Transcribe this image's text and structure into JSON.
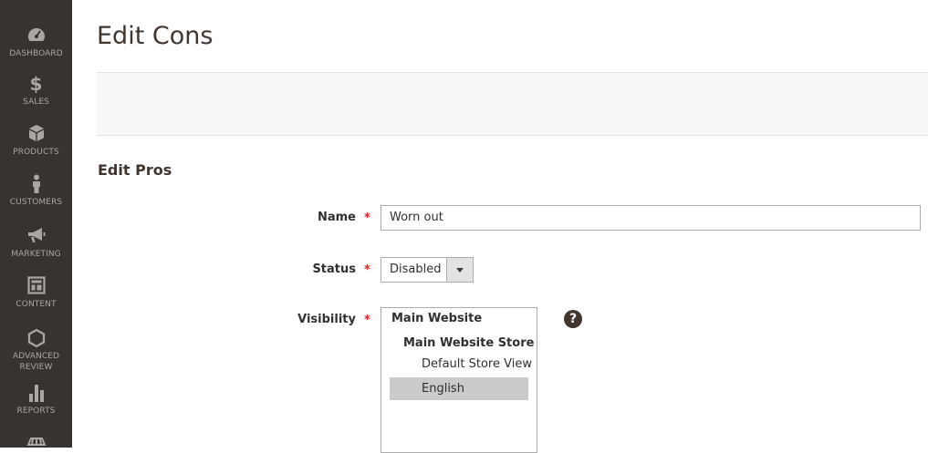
{
  "sidebar": {
    "items": [
      {
        "label": "DASHBOARD",
        "icon": "dashboard-icon"
      },
      {
        "label": "SALES",
        "icon": "dollar-icon"
      },
      {
        "label": "PRODUCTS",
        "icon": "box-icon"
      },
      {
        "label": "CUSTOMERS",
        "icon": "person-icon"
      },
      {
        "label": "MARKETING",
        "icon": "megaphone-icon"
      },
      {
        "label": "CONTENT",
        "icon": "layout-icon"
      },
      {
        "label_line1": "ADVANCED",
        "label_line2": "REVIEW",
        "icon": "hexagon-icon"
      },
      {
        "label": "REPORTS",
        "icon": "bar-chart-icon"
      }
    ]
  },
  "page": {
    "title": "Edit Cons",
    "section_title": "Edit Pros"
  },
  "form": {
    "name": {
      "label": "Name",
      "value": "Worn out",
      "required": "*"
    },
    "status": {
      "label": "Status",
      "value": "Disabled",
      "required": "*"
    },
    "visibility": {
      "label": "Visibility",
      "required": "*",
      "options": {
        "website": "Main Website",
        "store": "Main Website Store",
        "view1": "Default Store View",
        "view2": "English"
      },
      "help": "?"
    }
  },
  "colors": {
    "sidebar_bg": "#373330",
    "required": "#e22626",
    "selected_option_bg": "#cacaca"
  }
}
